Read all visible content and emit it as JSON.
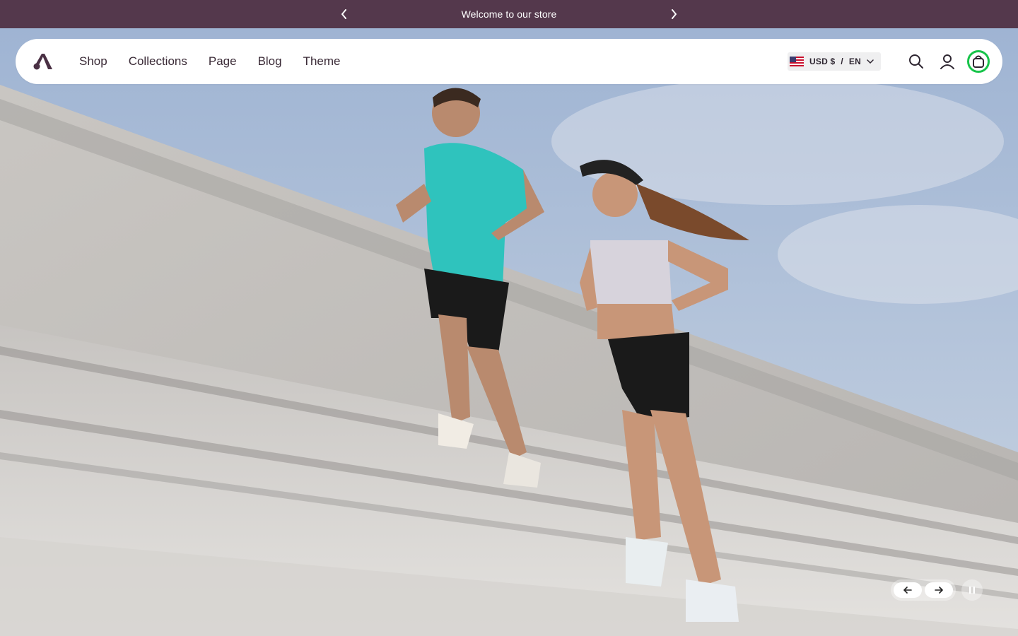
{
  "announcement": {
    "text": "Welcome to our store",
    "prev_icon": "chevron-left-icon",
    "next_icon": "chevron-right-icon",
    "background": "#54384c"
  },
  "header": {
    "logo_icon": "brand-logo-icon",
    "nav": [
      {
        "label": "Shop"
      },
      {
        "label": "Collections"
      },
      {
        "label": "Page"
      },
      {
        "label": "Blog"
      },
      {
        "label": "Theme"
      }
    ],
    "locale": {
      "flag_icon": "us-flag-icon",
      "currency": "USD $",
      "separator": "/",
      "language": "EN",
      "dropdown_icon": "chevron-down-icon"
    },
    "search_icon": "search-icon",
    "account_icon": "user-icon",
    "cart_icon": "shopping-bag-icon",
    "cart_highlight_color": "#17c44a"
  },
  "hero": {
    "image": "two-runners-climbing-stairs-photo"
  },
  "slideshow": {
    "prev_icon": "arrow-left-icon",
    "next_icon": "arrow-right-icon",
    "pause_icon": "pause-icon"
  }
}
